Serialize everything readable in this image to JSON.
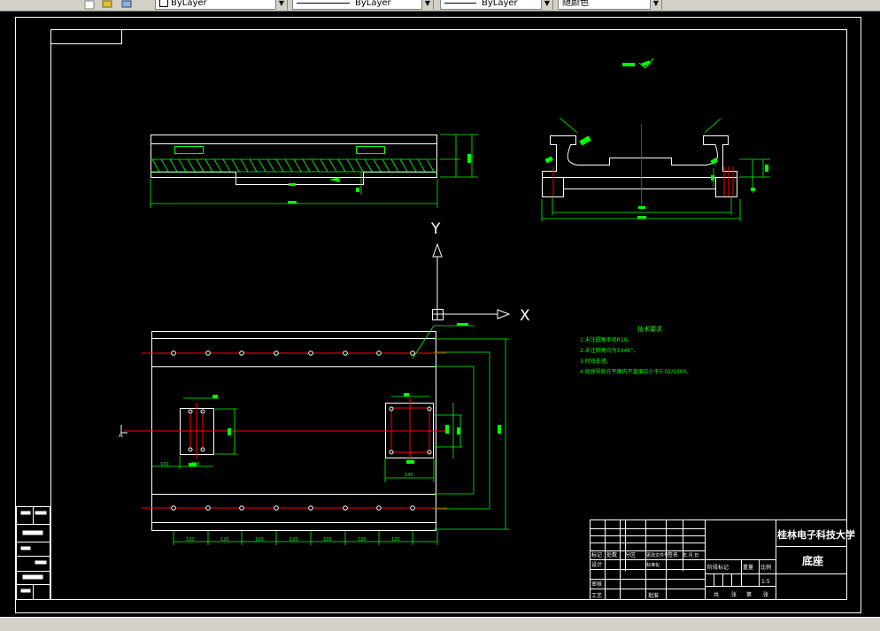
{
  "toolbar": {
    "layer_color": "ByLayer",
    "linetype": "ByLayer",
    "lineweight": "ByLayer",
    "plot_style": "随颜色"
  },
  "drawing": {
    "ucs_y": "Y",
    "ucs_x": "X",
    "tech_req": {
      "title": "技术要求",
      "items": [
        "1.未注圆角半径R10。",
        "2.未注倒角均为1X45°。",
        "3.时效处理。",
        "4.底座导轨在平面内不直度应小于0.02/1000。"
      ]
    },
    "section_mark": "A",
    "top_dims": [
      "120",
      "120",
      "120",
      "120",
      "120",
      "120",
      "120",
      "120"
    ],
    "mid_dims": [
      "100",
      "120",
      "140"
    ],
    "title_block": {
      "university": "桂林电子科技大学",
      "part_name": "底座",
      "scale": "1:5",
      "labels": [
        "标记",
        "处数",
        "分区",
        "更改文件号",
        "签名",
        "年.月.日",
        "设计",
        "审核",
        "工艺",
        "标准化",
        "批准",
        "阶段标记",
        "重量",
        "比例",
        "共",
        "张",
        "第",
        "张"
      ]
    },
    "colors": {
      "frame": "#ffffff",
      "line": "#ffffff",
      "dim": "#00ff00",
      "center": "#ff0000",
      "text": "#00ff00",
      "hatch": "#00ff00",
      "yellow": "#ffff00"
    }
  }
}
